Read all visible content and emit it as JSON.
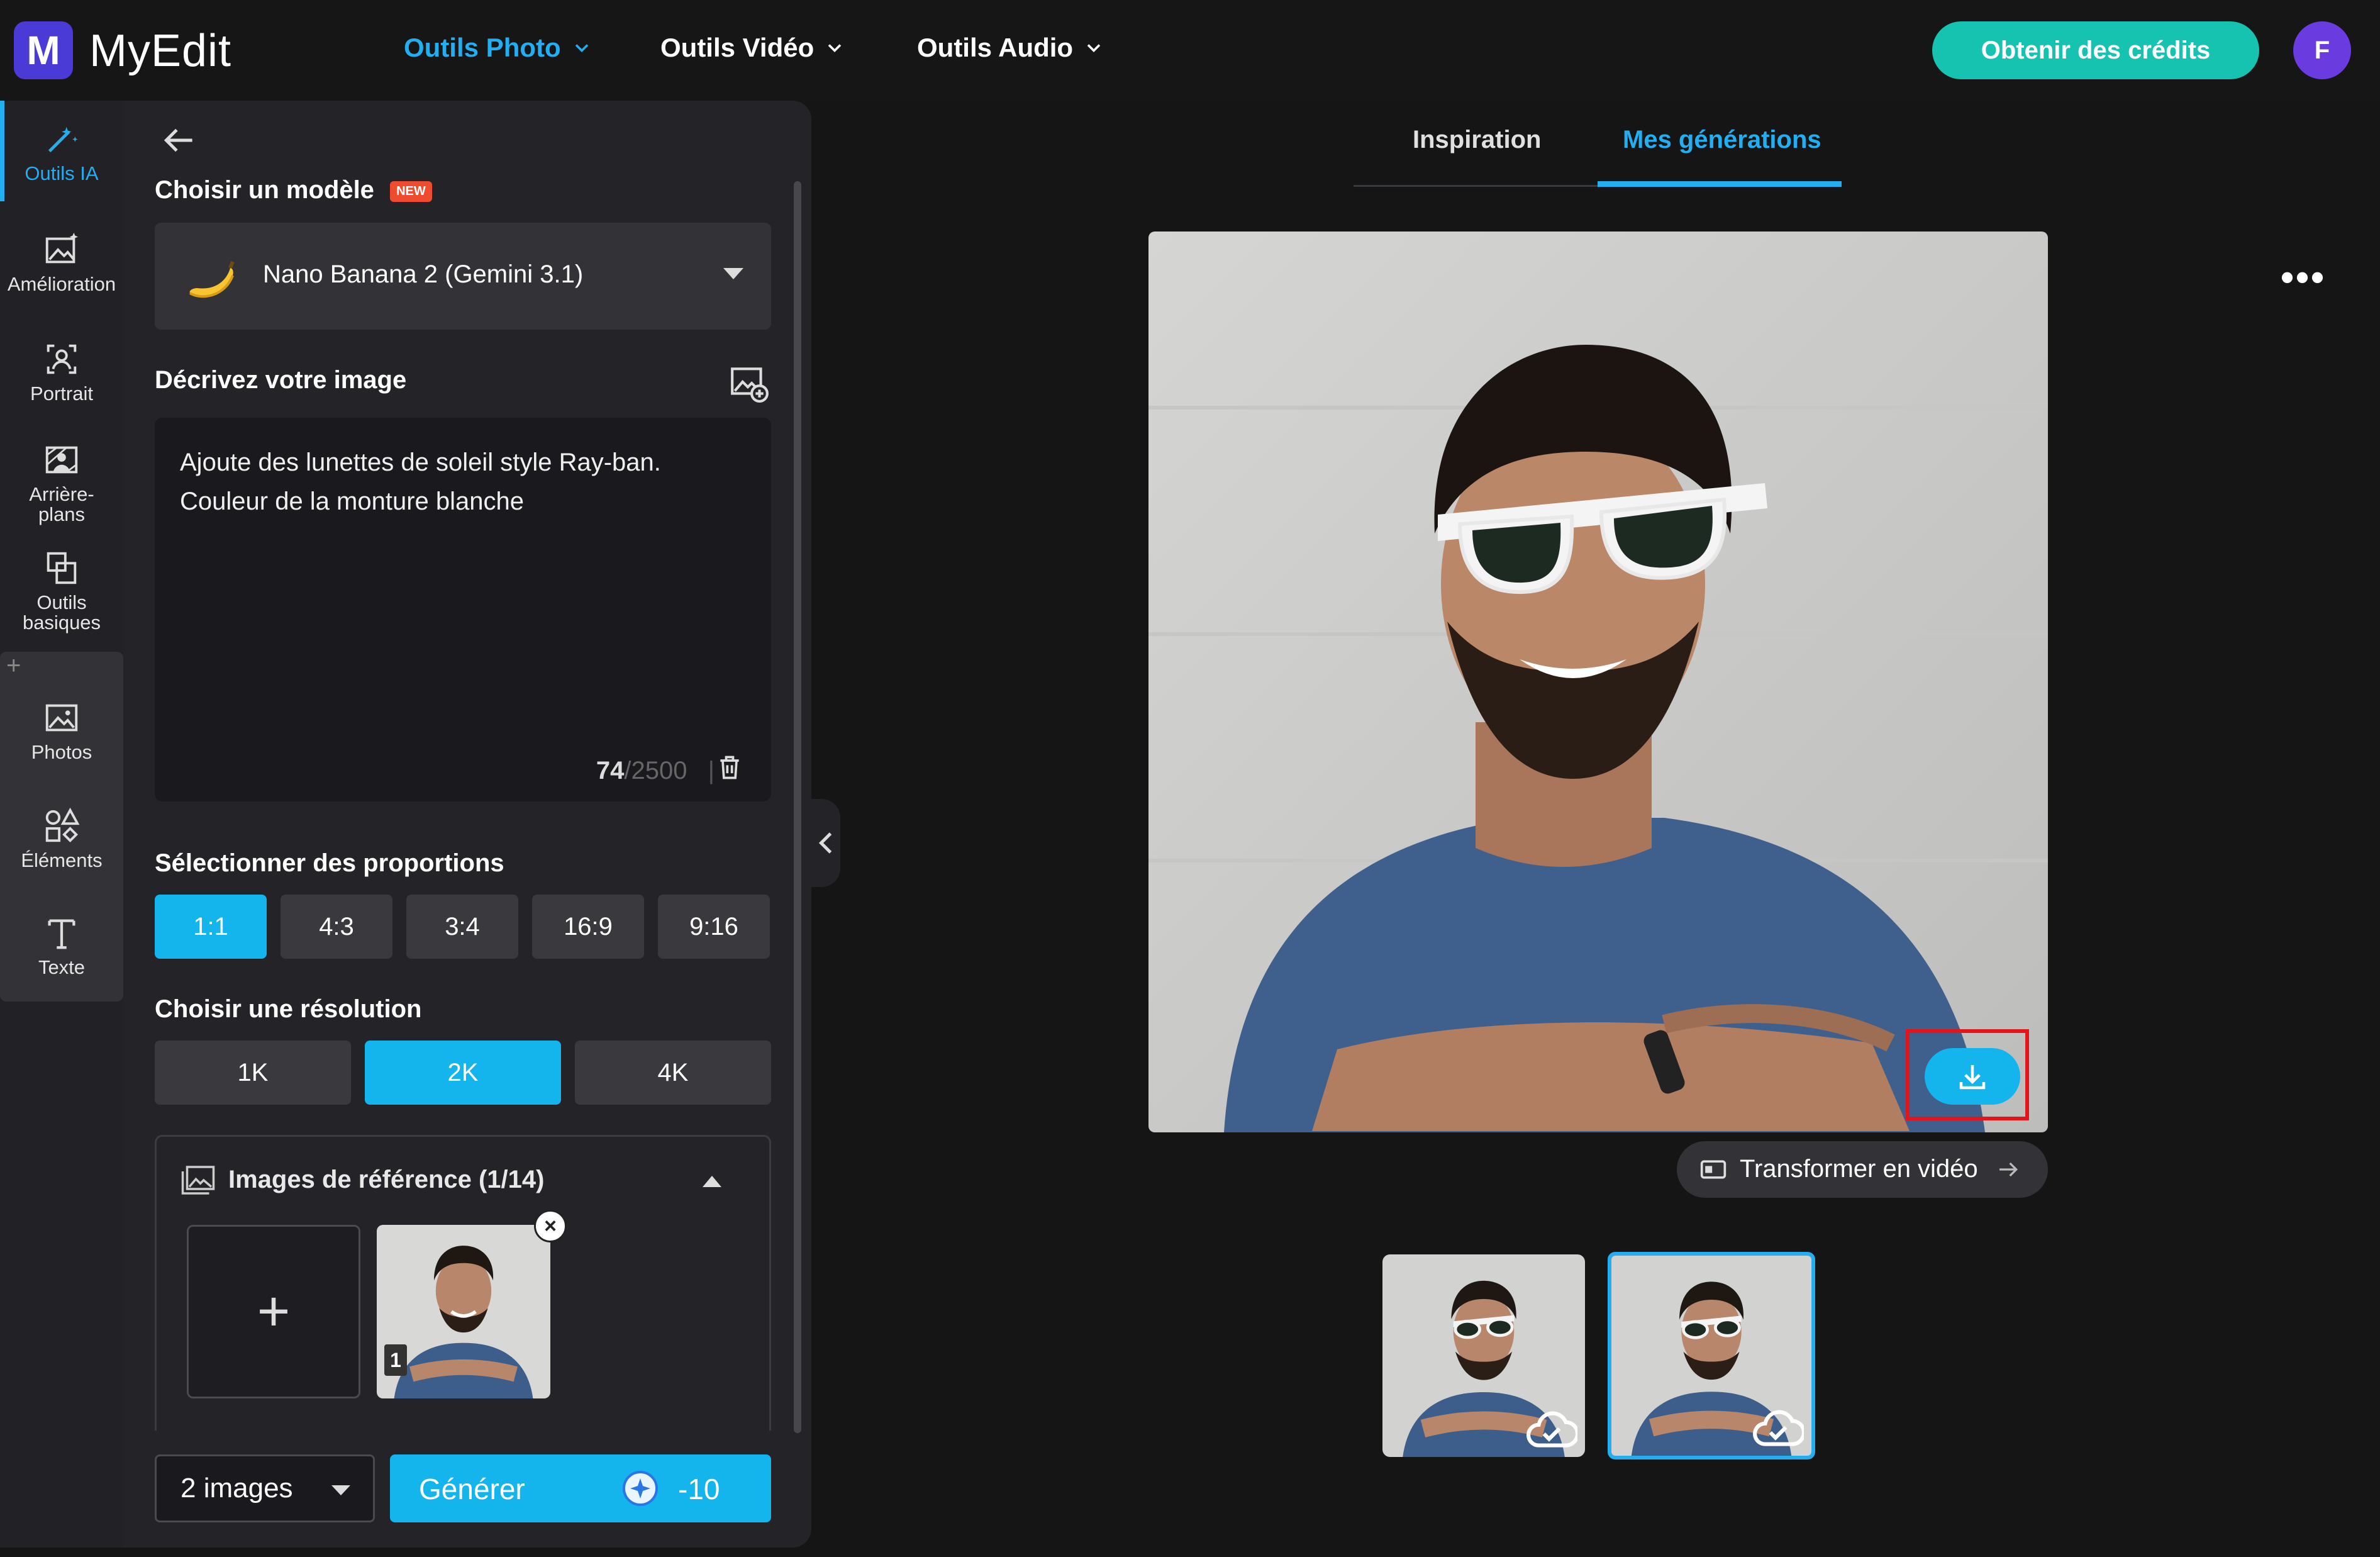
{
  "header": {
    "logo_letter": "M",
    "brand": "MyEdit",
    "nav": [
      {
        "label": "Outils Photo",
        "active": true
      },
      {
        "label": "Outils Vidéo",
        "active": false
      },
      {
        "label": "Outils Audio",
        "active": false
      }
    ],
    "credits_label": "Obtenir des crédits",
    "avatar_letter": "F"
  },
  "rail": {
    "items": [
      {
        "label": "Outils IA",
        "icon": "magic-wand-icon"
      },
      {
        "label": "Amélioration",
        "icon": "image-sparkle-icon"
      },
      {
        "label": "Portrait",
        "icon": "portrait-icon"
      },
      {
        "label": "Arrière-\nplans",
        "icon": "background-icon"
      },
      {
        "label": "Outils\nbasiques",
        "icon": "crop-icon"
      },
      {
        "label": "Photos",
        "icon": "photos-icon"
      },
      {
        "label": "Éléments",
        "icon": "elements-icon"
      },
      {
        "label": "Texte",
        "icon": "text-icon"
      }
    ],
    "plus": "+"
  },
  "panel": {
    "model_label": "Choisir un modèle",
    "new_badge": "NEW",
    "model_name": "Nano Banana 2 (Gemini 3.1)",
    "describe_label": "Décrivez votre image",
    "prompt_text": "Ajoute des lunettes de soleil style Ray-ban.\nCouleur de la monture blanche",
    "char_count": "74",
    "char_max": "/2500",
    "counter_sep": "|",
    "proportions_label": "Sélectionner des proportions",
    "proportions": [
      "1:1",
      "4:3",
      "3:4",
      "16:9",
      "9:16"
    ],
    "proportions_selected": "1:1",
    "resolution_label": "Choisir une résolution",
    "resolutions": [
      "1K",
      "2K",
      "4K"
    ],
    "resolution_selected": "2K",
    "reference_label": "Images de référence (1/14)",
    "reference_add": "+",
    "reference_index": "1",
    "reference_close": "×",
    "image_count": "2 images",
    "generate_label": "Générer",
    "generate_cost": "-10"
  },
  "main": {
    "tabs": [
      {
        "label": "Inspiration",
        "active": false
      },
      {
        "label": "Mes générations",
        "active": true
      }
    ],
    "more": "•••",
    "video_label": "Transformer en vidéo"
  },
  "colors": {
    "accent": "#14b4ec",
    "credits": "#16c2b0",
    "avatar": "#6a3ce0",
    "logo": "#4b3bd6",
    "highlight": "#e3151b"
  }
}
